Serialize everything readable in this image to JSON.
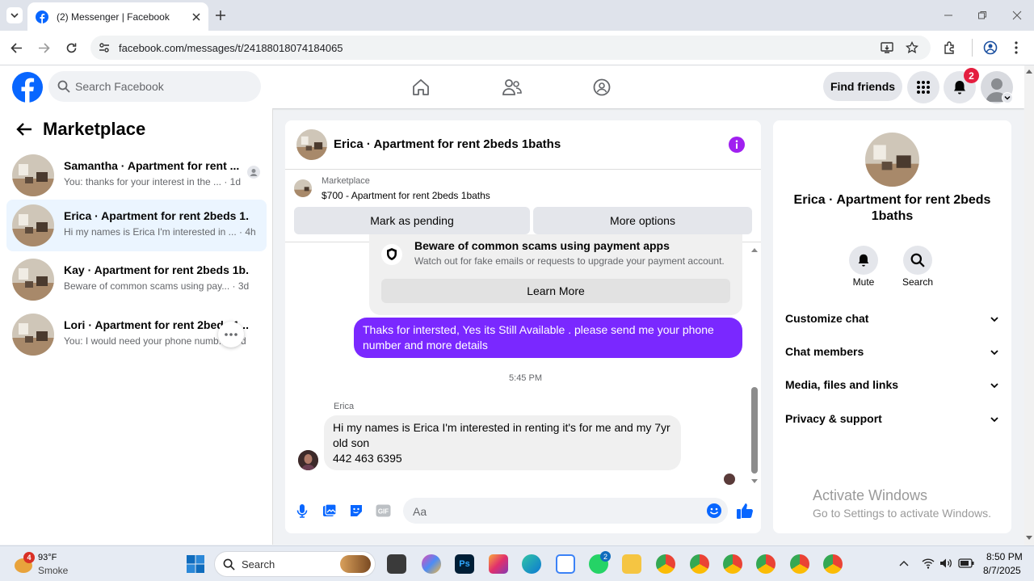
{
  "browser": {
    "tab_title": "(2) Messenger | Facebook",
    "url": "facebook.com/messages/t/24188018074184065"
  },
  "header": {
    "search_placeholder": "Search Facebook",
    "find_friends": "Find friends",
    "notification_count": "2",
    "brand_color": "#0866ff"
  },
  "left": {
    "title": "Marketplace",
    "conversations": [
      {
        "name": "Samantha · Apartment for rent ...",
        "preview": "You: thanks for your interest in the ... · 1d"
      },
      {
        "name": "Erica · Apartment for rent 2beds 1...",
        "preview": "Hi my names is Erica I'm interested in ... · 4h"
      },
      {
        "name": "Kay · Apartment for rent 2beds 1b...",
        "preview": "Beware of common scams using pay... · 3d"
      },
      {
        "name": "Lori · Apartment for rent 2beds 1...",
        "preview": "You: I would need your phone numb... · 3d"
      }
    ]
  },
  "chat": {
    "title": "Erica · Apartment for rent 2beds 1baths",
    "listing_label": "Marketplace",
    "listing_text": "$700 - Apartment for rent 2beds 1baths",
    "mark_pending": "Mark as pending",
    "more_options": "More options",
    "scam_title": "Beware of common scams using payment apps",
    "scam_text": "Watch out for fake emails or requests to upgrade your payment account.",
    "learn_more": "Learn More",
    "sent_message": "Thaks for intersted, Yes its Still Available . please send me your phone number and more details",
    "timestamp": "5:45 PM",
    "sender_name": "Erica",
    "received_message_line1": "Hi my names is Erica I'm interested in renting it's for me and my 7yr",
    "received_message_line2": "old son",
    "received_message_line3": "442 463 6395",
    "composer_placeholder": "Aa",
    "sent_bubble_color": "#7a28ff"
  },
  "right": {
    "name": "Erica · Apartment for rent 2beds 1baths",
    "mute": "Mute",
    "search": "Search",
    "sections": [
      "Customize chat",
      "Chat members",
      "Media, files and links",
      "Privacy & support"
    ],
    "watermark_title": "Activate Windows",
    "watermark_text": "Go to Settings to activate Windows."
  },
  "taskbar": {
    "temperature": "93°F",
    "weather": "Smoke",
    "weather_badge": "4",
    "search": "Search",
    "whatsapp_badge": "2",
    "time": "8:50 PM",
    "date": "8/7/2025"
  }
}
